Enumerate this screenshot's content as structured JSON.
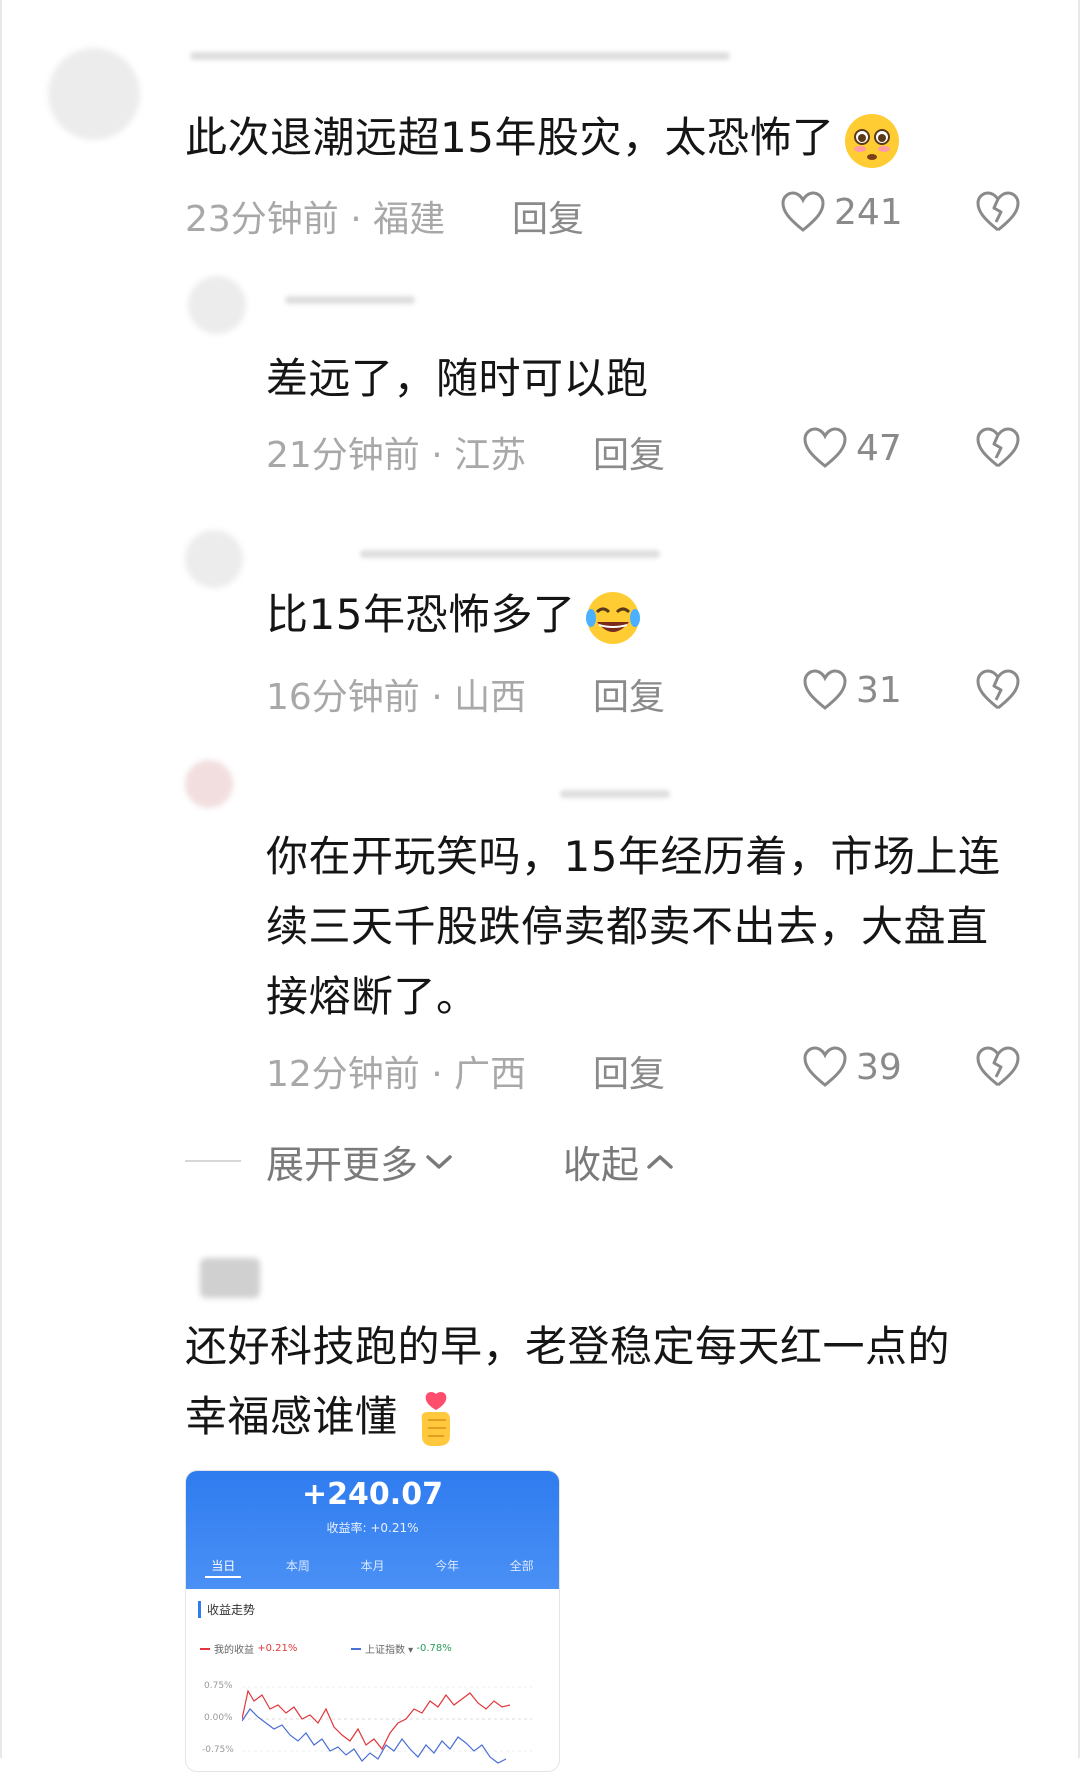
{
  "comments": [
    {
      "text": "此次退潮远超15年股灾，太恐怖了",
      "time_loc": "23分钟前 · 福建",
      "reply": "回复",
      "likes": "241",
      "emoji": "flushed-face"
    },
    {
      "text": "差远了，随时可以跑",
      "time_loc": "21分钟前 · 江苏",
      "reply": "回复",
      "likes": "47"
    },
    {
      "text": "比15年恐怖多了",
      "time_loc": "16分钟前 · 山西",
      "reply": "回复",
      "likes": "31",
      "emoji": "tears-of-joy"
    },
    {
      "text_lines": [
        "你在开玩笑吗，15年经历着，市场上连",
        "续三天千股跌停卖都卖不出去，大盘直",
        "接熔断了。"
      ],
      "time_loc": "12分钟前 · 广西",
      "reply": "回复",
      "likes": "39"
    }
  ],
  "thread_controls": {
    "expand_more": "展开更多",
    "collapse": "收起"
  },
  "post": {
    "text_lines": [
      "还好科技跑的早，老登稳定每天红一点的",
      "幸福感谁懂"
    ],
    "emoji": "finger-heart"
  },
  "card": {
    "amount": "+240.07",
    "rate": "收益率: +0.21%",
    "tabs": [
      "当日",
      "本周",
      "本月",
      "今年",
      "全部"
    ],
    "active_tab": "当日",
    "chart_title": "收益走势",
    "legend_mine": "我的收益",
    "legend_mine_value": "+0.21%",
    "legend_index": "上证指数 ▾",
    "legend_index_value": "-0.78%",
    "y_ticks": [
      "0.75%",
      "0.00%",
      "-0.75%"
    ]
  },
  "colors": {
    "accent": "#2f7cf0",
    "up": "#e2363b",
    "down": "#2a9d5c"
  }
}
